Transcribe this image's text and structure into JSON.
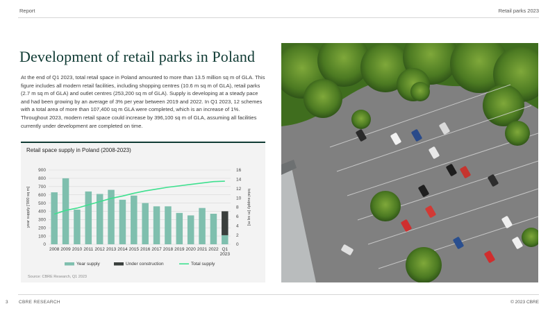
{
  "header": {
    "left": "Report",
    "right": "Retail parks 2023"
  },
  "title": "Development of retail parks in Poland",
  "body": "At the end of Q1 2023, total retail space in Poland amounted to more than 13.5 million sq m of GLA. This figure includes all modern retail facilities, including shopping centres (10.6 m sq m of GLA), retail parks (2.7 m sq m of GLA) and outlet centres (253,200 sq m of GLA). Supply is developing at a steady pace and had been growing by an average of 3% per year between 2019 and 2022. In Q1 2023, 12 schemes with a total area of more than 107,400 sq m GLA were completed, which is an increase of 1%. Throughout 2023, modern retail space could increase by 396,100 sq m of GLA, assuming all facilities currently under development are completed on time.",
  "chart": {
    "title": "Retail space supply in Poland (2008-2023)",
    "source": "Source: CBRE Research, Q1 2023"
  },
  "chart_data": {
    "type": "bar",
    "title": "Retail space supply in Poland (2008-2023)",
    "categories": [
      "2008",
      "2009",
      "2010",
      "2011",
      "2012",
      "2013",
      "2014",
      "2015",
      "2016",
      "2017",
      "2018",
      "2019",
      "2020",
      "2021",
      "2022",
      "Q1 2023"
    ],
    "tick_labels": [
      [
        "2008"
      ],
      [
        "2009"
      ],
      [
        "2010"
      ],
      [
        "2011"
      ],
      [
        "2012"
      ],
      [
        "2013"
      ],
      [
        "2014"
      ],
      [
        "2015"
      ],
      [
        "2016"
      ],
      [
        "2017"
      ],
      [
        "2018"
      ],
      [
        "2019"
      ],
      [
        "2020"
      ],
      [
        "2021"
      ],
      [
        "2022"
      ],
      [
        "Q1",
        "2023"
      ]
    ],
    "ylabel_left": "year supply ['000 sq m]",
    "ylabel_right": "total supply [m sq m]",
    "ylim_left": [
      0,
      900
    ],
    "yticks_left": [
      0,
      100,
      200,
      300,
      400,
      500,
      600,
      700,
      800,
      900
    ],
    "ylim_right": [
      0,
      16
    ],
    "yticks_right": [
      0,
      2,
      4,
      6,
      8,
      10,
      12,
      14,
      16
    ],
    "series": [
      {
        "name": "Year supply",
        "type": "bar",
        "axis": "left",
        "color": "#7fbfae",
        "values": [
          630,
          800,
          420,
          640,
          610,
          660,
          540,
          590,
          500,
          460,
          460,
          380,
          350,
          440,
          370,
          110
        ]
      },
      {
        "name": "Under construction",
        "type": "bar",
        "axis": "left",
        "color": "#3a3f3d",
        "values": [
          null,
          null,
          null,
          null,
          null,
          null,
          null,
          null,
          null,
          null,
          null,
          null,
          null,
          null,
          null,
          290
        ]
      },
      {
        "name": "Total supply",
        "type": "line",
        "axis": "right",
        "color": "#3ee08f",
        "values": [
          6.5,
          7.3,
          7.8,
          8.5,
          9.2,
          9.9,
          10.4,
          11.0,
          11.5,
          11.9,
          12.3,
          12.6,
          12.9,
          13.2,
          13.5,
          13.6
        ]
      }
    ],
    "legend": [
      "Year supply",
      "Under construction",
      "Total supply"
    ],
    "legend_position": "bottom",
    "grid": "horizontal"
  },
  "footer": {
    "page": "3",
    "brand": "CBRE RESEARCH",
    "copyright": "© 2023 CBRE"
  }
}
